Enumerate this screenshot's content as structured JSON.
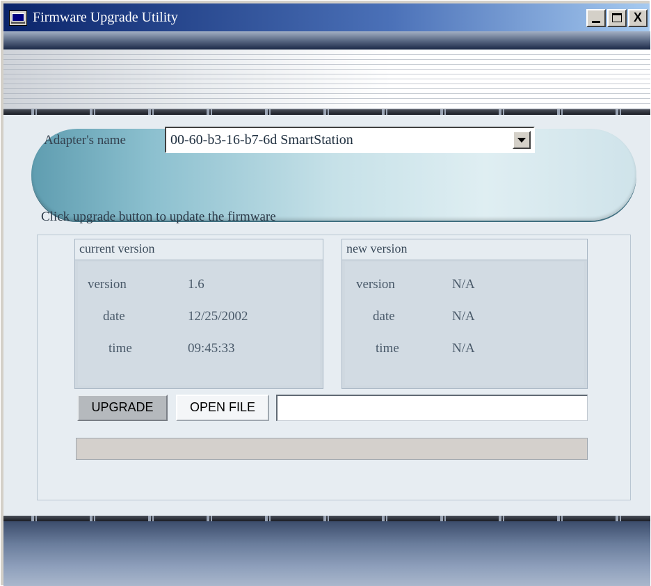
{
  "window": {
    "title": "Firmware Upgrade Utility",
    "controls": {
      "minimize": "minimize",
      "maximize": "maximize",
      "close": "X"
    }
  },
  "adapter": {
    "label": "Adapter's name",
    "selected": "00-60-b3-16-b7-6d  SmartStation"
  },
  "instruction": "Click upgrade button to update the firmware",
  "current_version": {
    "heading": "current version",
    "rows": [
      {
        "label": "version",
        "value": "1.6"
      },
      {
        "label": "date",
        "value": "12/25/2002"
      },
      {
        "label": "time",
        "value": "09:45:33"
      }
    ]
  },
  "new_version": {
    "heading": "new version",
    "rows": [
      {
        "label": "version",
        "value": "N/A"
      },
      {
        "label": "date",
        "value": "N/A"
      },
      {
        "label": "time",
        "value": "N/A"
      }
    ]
  },
  "actions": {
    "upgrade_label": "UPGRADE",
    "open_file_label": "OPEN FILE",
    "file_path": ""
  },
  "progress": {
    "percent": 0
  },
  "colors": {
    "titlebar": "#0a246a",
    "panel": "#e6ecf1",
    "accent": "#5f9db0"
  }
}
